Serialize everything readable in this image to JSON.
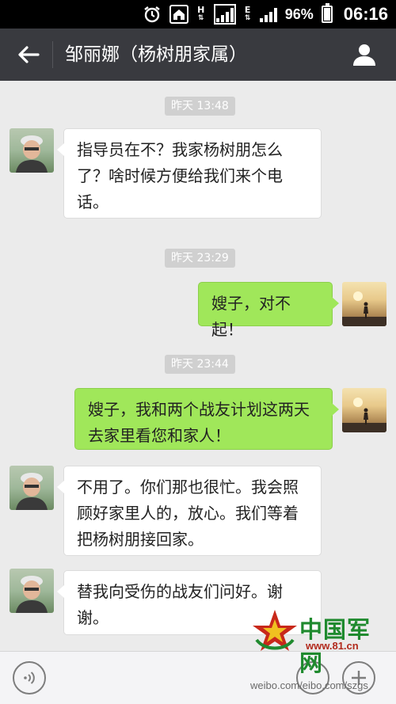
{
  "status_bar": {
    "network_h": "H",
    "network_e": "E",
    "battery": "96%",
    "time": "06:16"
  },
  "header": {
    "title": "邹丽娜（杨树朋家属）"
  },
  "messages": [
    {
      "type": "time",
      "text": "昨天 13:48"
    },
    {
      "type": "received",
      "lines": [
        "指导员在不？我家杨树朋怎么",
        "了？啥时候方便给我们来个电",
        "话。"
      ]
    },
    {
      "type": "time",
      "text": "昨天 23:29"
    },
    {
      "type": "sent",
      "lines": [
        "嫂子，对不起！"
      ]
    },
    {
      "type": "time",
      "text": "昨天 23:44"
    },
    {
      "type": "sent",
      "lines": [
        "嫂子，我和两个战友计划这两天",
        "去家里看您和家人！"
      ]
    },
    {
      "type": "received",
      "lines": [
        "不用了。你们那也很忙。我会照",
        "顾好家里人的，放心。我们等着",
        "把杨树朋接回家。"
      ]
    },
    {
      "type": "received",
      "lines": [
        "替我向受伤的战友们问好。谢",
        "谢。"
      ]
    }
  ],
  "watermark": {
    "logo_text": "中国军网",
    "logo_url": "www.81.cn",
    "weibo": "weibo.com/eibo.com/szgs"
  },
  "colors": {
    "title_bar": "#393a3f",
    "chat_background": "#ebebeb",
    "sent_bubble": "#a0e75a",
    "received_bubble": "#ffffff",
    "logo_green": "#1f8a2e",
    "logo_red": "#b22a1d"
  },
  "icons": [
    "alarm-icon",
    "home-icon",
    "signal-icon",
    "battery-icon",
    "back-arrow-icon",
    "person-icon",
    "voice-icon",
    "emoji-icon",
    "plus-icon"
  ]
}
